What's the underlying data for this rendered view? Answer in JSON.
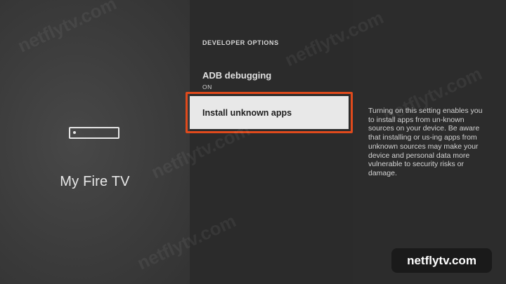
{
  "left": {
    "title": "My Fire TV",
    "icon": "fire-tv-device-icon"
  },
  "section_header": "DEVELOPER OPTIONS",
  "menu": {
    "items": [
      {
        "label": "ADB debugging",
        "value": "ON"
      },
      {
        "label": "Install unknown apps"
      }
    ]
  },
  "description": "Turning on this setting enables you to install apps from un-known sources on your device. Be aware that installing or us-ing apps from unknown sources may make your device and personal data more vulnerable to security risks or damage.",
  "watermark": "netflytv.com",
  "brand_badge": "netflytv.com",
  "colors": {
    "highlight_border": "#e04a1c",
    "selected_item_bg": "#e8e8e8"
  }
}
